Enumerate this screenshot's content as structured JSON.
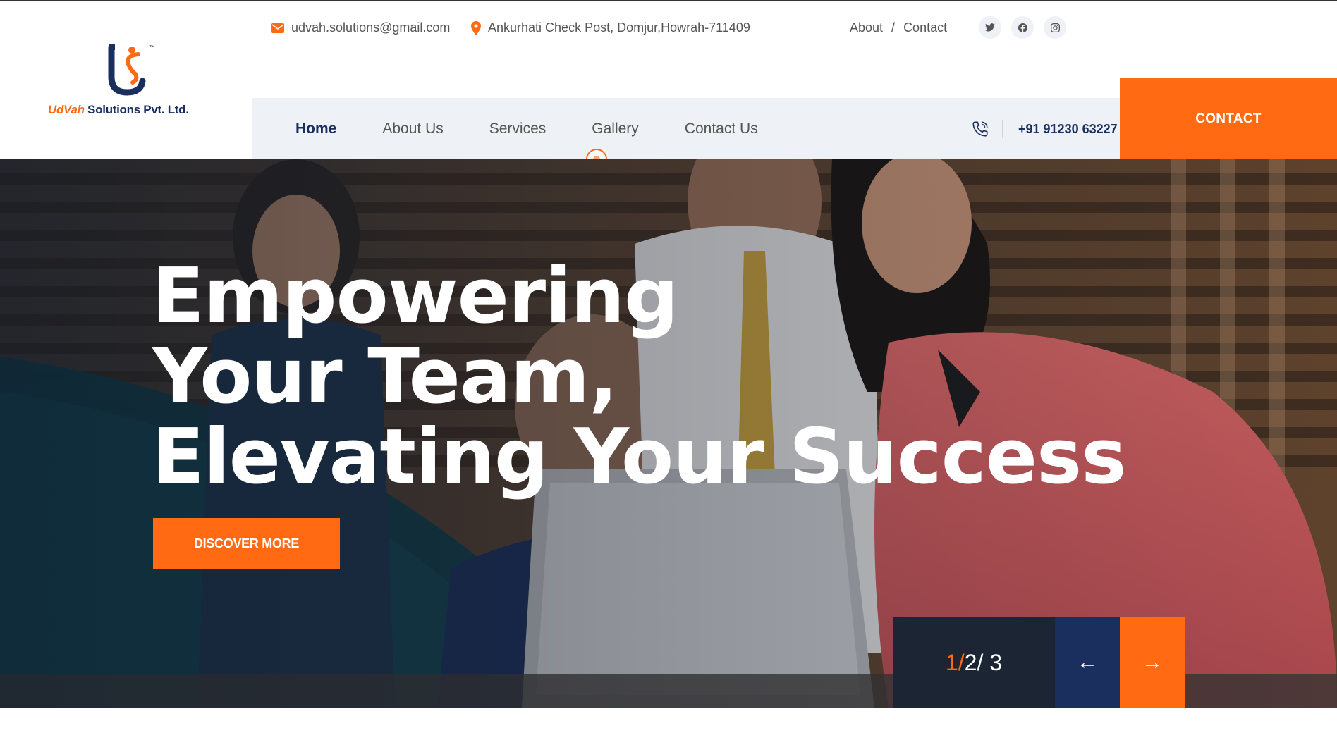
{
  "brand": {
    "name_part1": "UdVah",
    "name_part2": " Solutions Pvt. Ltd.",
    "trademark": "™",
    "colors": {
      "orange": "#ff6a13",
      "navy": "#1b2f5e"
    }
  },
  "topbar": {
    "email": "udvah.solutions@gmail.com",
    "address": "Ankurhati Check Post, Domjur,Howrah-711409",
    "links": {
      "about": "About",
      "separator": "/",
      "contact": "Contact"
    },
    "socials": [
      "twitter-icon",
      "facebook-icon",
      "instagram-icon"
    ]
  },
  "nav": {
    "items": [
      {
        "label": "Home",
        "active": true
      },
      {
        "label": "About Us"
      },
      {
        "label": "Services"
      },
      {
        "label": "Gallery"
      },
      {
        "label": "Contact Us"
      }
    ],
    "phone": "+91 91230 63227",
    "contact_button": "CONTACT"
  },
  "hero": {
    "title_line1": "Empowering",
    "title_line2": "Your Team,",
    "title_line3": "Elevating Your Success",
    "cta": "DISCOVER MORE",
    "slider": {
      "current": "1/",
      "rest": " 2/ 3",
      "prev": "←",
      "next": "→"
    }
  }
}
